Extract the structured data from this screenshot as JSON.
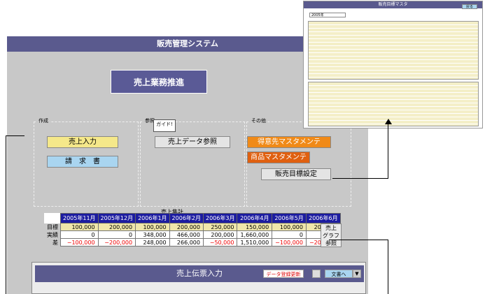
{
  "app": {
    "title": "販売管理システム"
  },
  "main_button": "売上業務推進",
  "panels": {
    "create": {
      "label": "作成",
      "btn1": "売上入力",
      "btn2": "請　求　書"
    },
    "reference": {
      "label": "参照",
      "btn1": "売上データ参照",
      "tooltip": "ガイド!"
    },
    "other": {
      "label": "その他",
      "btn1": "得意先マスタメンテ",
      "btn2": "商品マスタメンテ",
      "btn3": "販売目標設定"
    }
  },
  "summary": {
    "title": "売上集計",
    "months": [
      "2005年11月",
      "2005年12月",
      "2006年1月",
      "2006年2月",
      "2006年3月",
      "2006年4月",
      "2006年5月",
      "2006年6月"
    ],
    "rows": [
      {
        "label": "目標",
        "values": [
          "100,000",
          "200,000",
          "100,000",
          "200,000",
          "250,000",
          "150,000",
          "100,000",
          "200,000"
        ]
      },
      {
        "label": "実績",
        "values": [
          "0",
          "0",
          "348,000",
          "466,000",
          "200,000",
          "1,660,000",
          "0",
          "0"
        ]
      },
      {
        "label": "差",
        "values": [
          "−100,000",
          "−200,000",
          "248,000",
          "266,000",
          "−50,000",
          "1,510,000",
          "−100,000",
          "−200,000"
        ]
      }
    ],
    "graph_button": [
      "売上",
      "グラフ",
      "参照"
    ]
  },
  "subwindow": {
    "title": "売上伝票入力",
    "update_btn": "データ登録更新",
    "doc_btn": "文書へ"
  },
  "thumbnail": {
    "title": "販売目標マスタ",
    "year": "2005年",
    "back": "戻る"
  }
}
